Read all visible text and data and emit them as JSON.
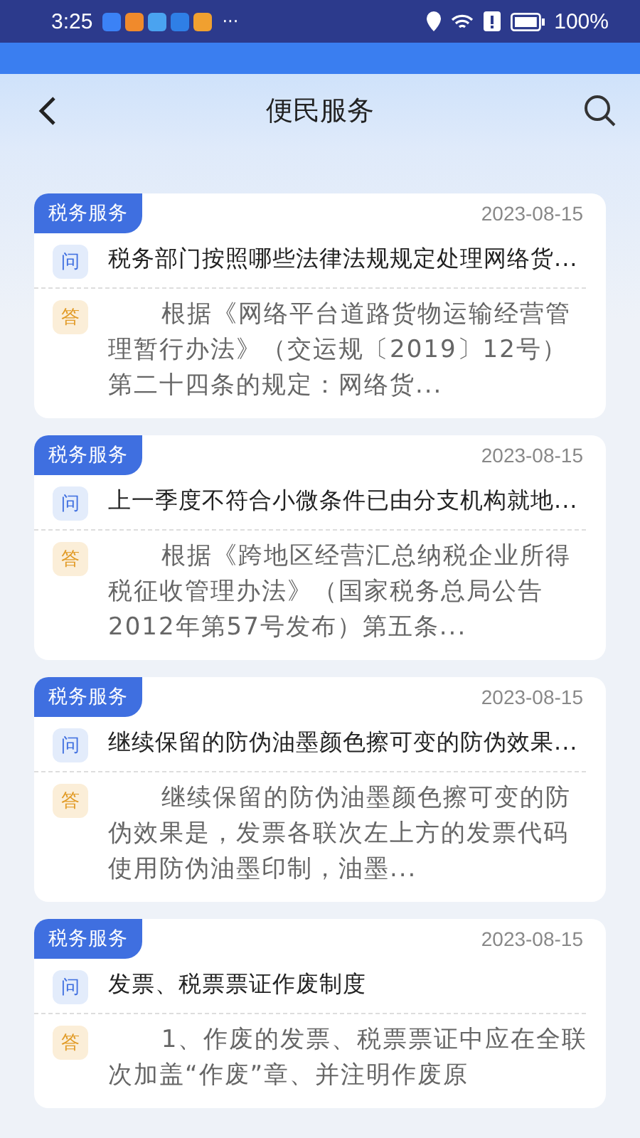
{
  "status_bar": {
    "time": "3:25",
    "more": "···",
    "battery": "100%"
  },
  "header": {
    "title": "便民服务"
  },
  "cards": [
    {
      "tag": "税务服务",
      "date": "2023-08-15",
      "q_mark": "问",
      "question": "税务部门按照哪些法律法规规定处理网络货...",
      "a_mark": "答",
      "answer": "根据《网络平台道路货物运输经营管理暂行办法》（交运规〔2019〕12号）第二十四条的规定：网络货..."
    },
    {
      "tag": "税务服务",
      "date": "2023-08-15",
      "q_mark": "问",
      "question": "上一季度不符合小微条件已由分支机构就地...",
      "a_mark": "答",
      "answer": "根据《跨地区经营汇总纳税企业所得税征收管理办法》（国家税务总局公告2012年第57号发布）第五条..."
    },
    {
      "tag": "税务服务",
      "date": "2023-08-15",
      "q_mark": "问",
      "question": "继续保留的防伪油墨颜色擦可变的防伪效果...",
      "a_mark": "答",
      "answer": "继续保留的防伪油墨颜色擦可变的防伪效果是，发票各联次左上方的发票代码使用防伪油墨印制，油墨..."
    },
    {
      "tag": "税务服务",
      "date": "2023-08-15",
      "q_mark": "问",
      "question": "发票、税票票证作废制度",
      "a_mark": "答",
      "answer": "1、作废的发票、税票票证中应在全联次加盖“作废”章、并注明作废原"
    }
  ]
}
